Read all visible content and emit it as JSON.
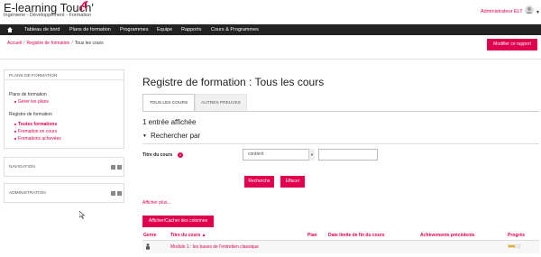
{
  "header": {
    "brand_title": "E-learning Touch'",
    "brand_subtitle": "Ingénierie - Développement - Formation",
    "user_name": "Administrateur ELT"
  },
  "nav": {
    "items": [
      "Tableau de bord",
      "Plans de formation",
      "Programmes",
      "Equipe",
      "Rapports",
      "Cours & Programmes"
    ]
  },
  "breadcrumb": {
    "items": [
      "Accueil",
      "Registre de formation",
      "Tous les cours"
    ]
  },
  "modify_button": "Modifier ce rapport",
  "sidebar": {
    "plans_panel": {
      "title": "PLANS DE FORMATION",
      "section1_label": "Plans de formation",
      "section1_links": [
        "Gérer les plans"
      ],
      "section2_label": "Registre de formation",
      "section2_links": [
        "Toutes formations",
        "Formation en cours",
        "Formations achevées"
      ]
    },
    "navigation_title": "NAVIGATION",
    "administration_title": "ADMINISTRATION"
  },
  "main": {
    "heading": "Registre de formation : Tous les cours",
    "tabs": [
      "TOUS LES COURS",
      "AUTRES PREUVES"
    ],
    "entries_count": "1 entrée affichée",
    "search_toggle": "Rechercher par",
    "filter": {
      "label": "Titre du cours",
      "operator": "contient",
      "value": ""
    },
    "search_button": "Recherche",
    "clear_button": "Effacer",
    "more_link": "Afficher plus...",
    "columns_button": "Afficher/Cacher des colonnes",
    "table": {
      "headers": [
        "Genre",
        "Titre du cours ▲",
        "Plan",
        "Date limite de fin du cours",
        "Achèvements précédents",
        "Progrès"
      ],
      "rows": [
        {
          "title": "Module 1 : les bases de l'entretien classique",
          "progress": 0.55
        }
      ]
    }
  },
  "colors": {
    "accent": "#e0004d",
    "navbar": "#222222",
    "progress": "#f0ad00"
  }
}
